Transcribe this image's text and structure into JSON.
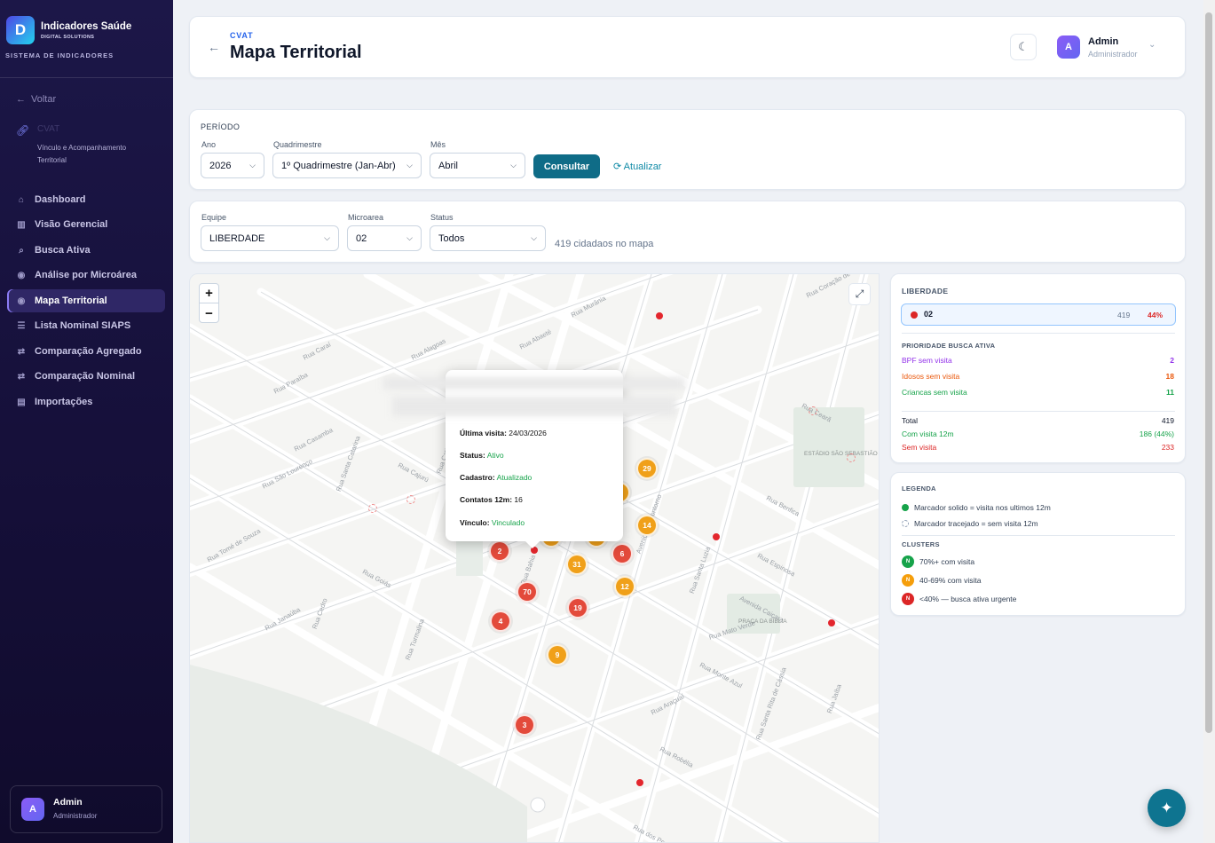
{
  "sidebar": {
    "brand_title": "Indicadores Saúde",
    "brand_sub": "DIGITAL SOLUTIONS",
    "system": "SISTEMA DE INDICADORES",
    "back": "Voltar",
    "module": {
      "title": "CVAT",
      "desc": "Vínculo e Acompanhamento Territorial"
    },
    "items": [
      {
        "label": "Dashboard",
        "icon": "home-icon"
      },
      {
        "label": "Visão Gerencial",
        "icon": "bar-chart-icon"
      },
      {
        "label": "Busca Ativa",
        "icon": "search-icon"
      },
      {
        "label": "Análise por Microárea",
        "icon": "pin-icon"
      },
      {
        "label": "Mapa Territorial",
        "icon": "pin-icon",
        "active": true
      },
      {
        "label": "Lista Nominal SIAPS",
        "icon": "list-icon"
      },
      {
        "label": "Comparação Agregado",
        "icon": "swap-icon"
      },
      {
        "label": "Comparação Nominal",
        "icon": "swap-icon"
      },
      {
        "label": "Importações",
        "icon": "file-icon"
      }
    ],
    "user": {
      "initial": "A",
      "name": "Admin",
      "role": "Administrador"
    }
  },
  "header": {
    "subtitle": "CVAT",
    "title": "Mapa Territorial",
    "user": {
      "initial": "A",
      "name": "Admin",
      "role": "Administrador"
    }
  },
  "periodo": {
    "section": "PERÍODO",
    "ano": {
      "label": "Ano",
      "value": "2026"
    },
    "quadrimestre": {
      "label": "Quadrimestre",
      "value": "1º Quadrimestre (Jan-Abr)"
    },
    "mes": {
      "label": "Mês",
      "value": "Abril"
    },
    "consultar": "Consultar",
    "atualizar": "Atualizar"
  },
  "filtros": {
    "equipe": {
      "label": "Equipe",
      "value": "LIBERDADE"
    },
    "microarea": {
      "label": "Microarea",
      "value": "02"
    },
    "status": {
      "label": "Status",
      "value": "Todos"
    },
    "count": "419 cidadaos no mapa"
  },
  "map": {
    "zoom_in": "+",
    "zoom_out": "−",
    "streets": [
      "Rua Murânia",
      "Rua Coração de Jesus",
      "Rua Caraí",
      "Rua Alagoas",
      "Rua Abaeté",
      "Rua Paraíba",
      "Rua Cearã",
      "Rua Casamba",
      "Rua São Lourenço",
      "Rua Cajurú",
      "Rua Tomé de Souza",
      "Rua Goiás",
      "Rua Santa Catarina",
      "Rua Janaúba",
      "Rua Benfica",
      "Rua Espinosa",
      "Avenida Caiçara",
      "Rua Mato Verde",
      "Rua Monte Azul",
      "Rua Araçuaí",
      "Avenida do Contorno",
      "Rua Santa Luzia",
      "Rua Robélia",
      "Rua dos Pereiras",
      "Rua Santa Rita de Cássia",
      "Rua Jaíba",
      "Rua Catiraia",
      "Rua Turmalina",
      "Rua Bahia",
      "Rua Cedro"
    ],
    "places": [
      "ESTÁDIO SÃO SEBASTIÃO",
      "PRAÇA DA BÍBLIA"
    ],
    "clusters": [
      {
        "value": "29",
        "level": "mid"
      },
      {
        "value": "14",
        "level": "mid"
      },
      {
        "value": "2",
        "level": "low"
      },
      {
        "value": "31",
        "level": "mid"
      },
      {
        "value": "6",
        "level": "low"
      },
      {
        "value": "70",
        "level": "low"
      },
      {
        "value": "12",
        "level": "mid"
      },
      {
        "value": "19",
        "level": "low"
      },
      {
        "value": "4",
        "level": "low"
      },
      {
        "value": "9",
        "level": "mid"
      },
      {
        "value": "3",
        "level": "low"
      }
    ],
    "popup": {
      "ultima_visita_label": "Última visita:",
      "ultima_visita": "24/03/2026",
      "status_label": "Status:",
      "status": "Ativo",
      "cadastro_label": "Cadastro:",
      "cadastro": "Atualizado",
      "contatos_label": "Contatos 12m:",
      "contatos": "16",
      "vinculo_label": "Vínculo:",
      "vinculo": "Vinculado"
    }
  },
  "summary": {
    "team": "LIBERDADE",
    "micro": {
      "name": "02",
      "count": "419",
      "pct": "44%"
    },
    "priority_title": "PRIORIDADE BUSCA ATIVA",
    "priority": [
      {
        "label": "BPF sem visita",
        "value": "2",
        "color": "#9333ea"
      },
      {
        "label": "Idosos sem visita",
        "value": "18",
        "color": "#ea580c"
      },
      {
        "label": "Criancas sem visita",
        "value": "11",
        "color": "#16a34a"
      }
    ],
    "total_label": "Total",
    "total": "419",
    "com_visita_label": "Com visita 12m",
    "com_visita": "186 (44%)",
    "sem_visita_label": "Sem visita",
    "sem_visita": "233"
  },
  "legend": {
    "title": "LEGENDA",
    "solid": "Marcador solido = visita nos ultimos 12m",
    "dashed": "Marcador tracejado = sem visita 12m",
    "clusters_title": "CLUSTERS",
    "badge": "N",
    "c70": "70%+ com visita",
    "c40": "40-69% com visita",
    "c0": "<40% — busca ativa urgente",
    "colors": {
      "green": "#16a34a",
      "orange": "#f59e0b",
      "red": "#dc2626"
    }
  }
}
